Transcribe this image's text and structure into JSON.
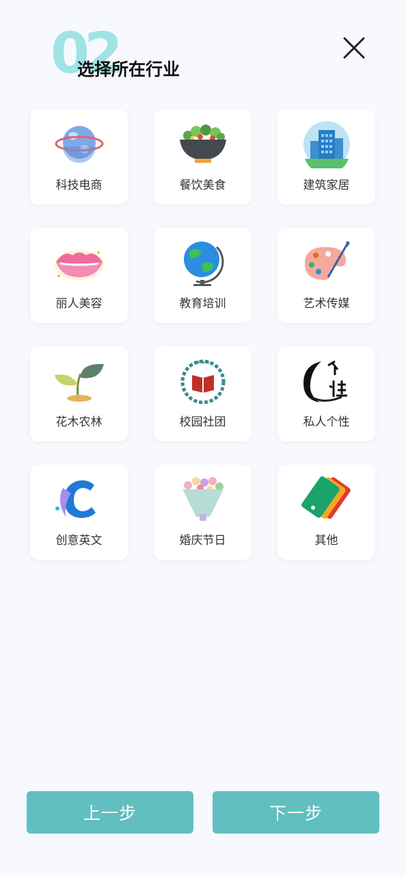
{
  "header": {
    "step_number": "02",
    "title": "选择所在行业"
  },
  "industries": [
    {
      "label": "科技电商",
      "icon": "planet-icon"
    },
    {
      "label": "餐饮美食",
      "icon": "salad-bowl-icon"
    },
    {
      "label": "建筑家居",
      "icon": "building-icon"
    },
    {
      "label": "丽人美容",
      "icon": "lips-icon"
    },
    {
      "label": "教育培训",
      "icon": "globe-icon"
    },
    {
      "label": "艺术传媒",
      "icon": "palette-icon"
    },
    {
      "label": "花木农林",
      "icon": "sprout-icon"
    },
    {
      "label": "校园社团",
      "icon": "book-wreath-icon"
    },
    {
      "label": "私人个性",
      "icon": "ink-calligraphy-icon"
    },
    {
      "label": "创意英文",
      "icon": "letter-c-icon"
    },
    {
      "label": "婚庆节日",
      "icon": "bouquet-icon"
    },
    {
      "label": "其他",
      "icon": "tags-icon"
    }
  ],
  "footer": {
    "prev_label": "上一步",
    "next_label": "下一步"
  },
  "colors": {
    "accent": "#62bfc0",
    "step_badge": "#9fe3e6",
    "background": "#f7f9fe"
  }
}
